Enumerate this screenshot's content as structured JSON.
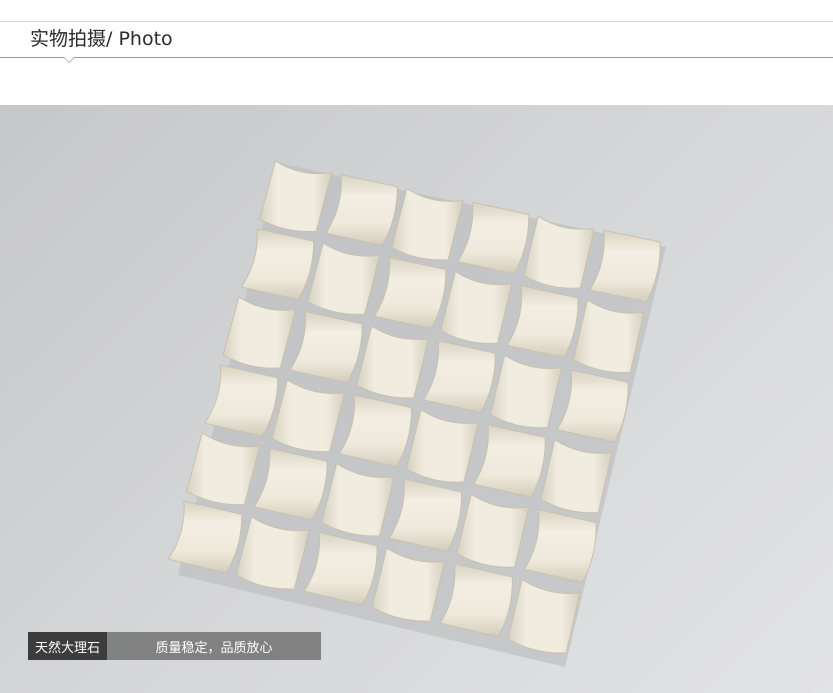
{
  "header": {
    "title": "实物拍摄/ Photo"
  },
  "photo": {
    "subject": "mosaic-tile-sheet",
    "grid_rows": 6,
    "grid_cols": 6
  },
  "caption": {
    "label": "天然大理石",
    "text": "质量稳定，品质放心"
  },
  "colors": {
    "background": "#ffffff",
    "photo_bg": "#d2d3d5",
    "tile": "#ece6d6",
    "caption_dark": "#3c3c3c",
    "caption_mid": "#6e6e6e"
  }
}
